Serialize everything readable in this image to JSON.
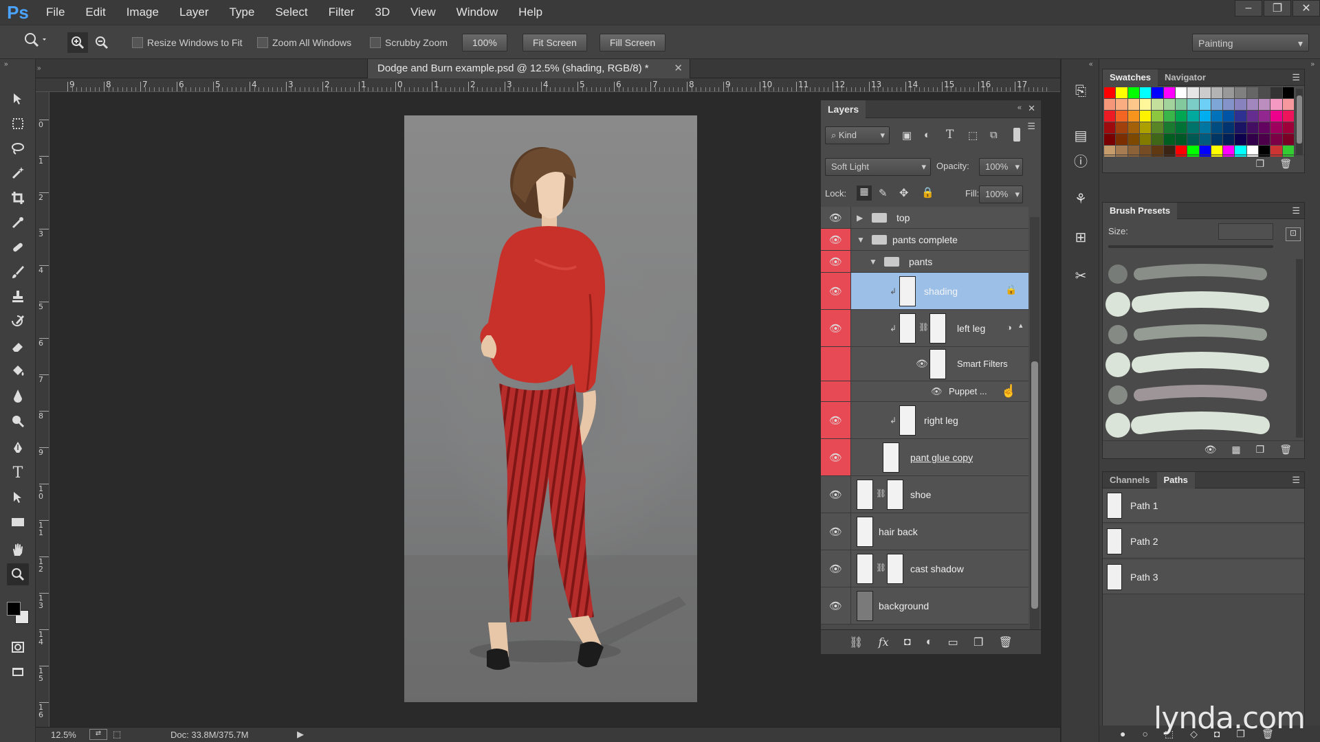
{
  "app": {
    "logo": "Ps",
    "menu": [
      "File",
      "Edit",
      "Image",
      "Layer",
      "Type",
      "Select",
      "Filter",
      "3D",
      "View",
      "Window",
      "Help"
    ],
    "window_controls": [
      "–",
      "❐",
      "✕"
    ]
  },
  "options": {
    "resize_windows": "Resize Windows to Fit",
    "zoom_all": "Zoom All Windows",
    "scrubby": "Scrubby Zoom",
    "zoom_100": "100%",
    "fit_screen": "Fit Screen",
    "fill_screen": "Fill Screen",
    "workspace": "Painting"
  },
  "tabs": {
    "active": "Dodge and Burn example.psd @ 12.5% (shading, RGB/8) *",
    "close": "✕"
  },
  "ruler": {
    "h_labels": [
      "9",
      "8",
      "7",
      "6",
      "5",
      "4",
      "3",
      "2",
      "1",
      "0",
      "1",
      "2",
      "3",
      "4",
      "5",
      "6",
      "7",
      "8",
      "9",
      "10",
      "11",
      "12",
      "13",
      "14",
      "15",
      "16",
      "17"
    ],
    "v_labels": [
      "0",
      "1",
      "2",
      "3",
      "4",
      "5",
      "6",
      "7",
      "8",
      "9",
      "1 0",
      "1 1",
      "1 2",
      "1 3",
      "1 4",
      "1 5",
      "1 6"
    ]
  },
  "status": {
    "zoom": "12.5%",
    "doc": "Doc: 33.8M/375.7M"
  },
  "layers": {
    "title": "Layers",
    "kind": "Kind",
    "blend_mode": "Soft Light",
    "opacity_label": "Opacity:",
    "opacity": "100%",
    "lock_label": "Lock:",
    "fill_label": "Fill:",
    "fill": "100%",
    "items": [
      {
        "name": "top"
      },
      {
        "name": "pants complete"
      },
      {
        "name": "pants"
      },
      {
        "name": "shading"
      },
      {
        "name": "left leg"
      },
      {
        "name": "Smart Filters"
      },
      {
        "name": "Puppet ..."
      },
      {
        "name": "right leg"
      },
      {
        "name": "pant glue copy"
      },
      {
        "name": "shoe"
      },
      {
        "name": "hair back"
      },
      {
        "name": "cast shadow"
      },
      {
        "name": "background"
      }
    ]
  },
  "swatches": {
    "tabs": [
      "Swatches",
      "Navigator"
    ],
    "colors": [
      "#ff0000",
      "#ffff00",
      "#00ff00",
      "#00ffff",
      "#0000ff",
      "#ff00ff",
      "#ffffff",
      "#e6e6e6",
      "#cccccc",
      "#b3b3b3",
      "#999999",
      "#808080",
      "#666666",
      "#4d4d4d",
      "#333333",
      "#000000",
      "#f7977a",
      "#f9ad81",
      "#fdc68a",
      "#fff79a",
      "#c4df9b",
      "#a3d39c",
      "#82ca9d",
      "#7bcdc8",
      "#6ecff6",
      "#7ea7d8",
      "#8493ca",
      "#8882be",
      "#a187be",
      "#bc8dbf",
      "#f49ac2",
      "#f6989d",
      "#ed1c24",
      "#f26522",
      "#f7941d",
      "#fff200",
      "#8dc73f",
      "#39b54a",
      "#00a651",
      "#00a99d",
      "#00aeef",
      "#0072bc",
      "#0054a6",
      "#2e3192",
      "#662d91",
      "#92278f",
      "#ec008c",
      "#ed145b",
      "#9e0b0f",
      "#a0410d",
      "#a36209",
      "#aba000",
      "#598527",
      "#1a7b30",
      "#007236",
      "#00746b",
      "#0076a3",
      "#004b80",
      "#003471",
      "#1b1464",
      "#440e62",
      "#630460",
      "#9e005d",
      "#9e0039",
      "#790000",
      "#7b2e00",
      "#7d4900",
      "#827b00",
      "#406618",
      "#005e20",
      "#005826",
      "#005952",
      "#005b7f",
      "#003663",
      "#002157",
      "#0d004c",
      "#32004b",
      "#4b0049",
      "#7b0046",
      "#7a0026",
      "#c69c6d",
      "#a67c52",
      "#8c6239",
      "#754c24",
      "#603913",
      "#3c2415",
      "#ff0000",
      "#00ff00",
      "#0000ff",
      "#ffff00",
      "#ff00ff",
      "#00ffff",
      "#ffffff",
      "#000000",
      "#cc3333",
      "#33cc33"
    ]
  },
  "brush_presets": {
    "title": "Brush Presets",
    "size_label": "Size:"
  },
  "paths": {
    "tabs": [
      "Channels",
      "Paths"
    ],
    "items": [
      "Path 1",
      "Path 2",
      "Path 3"
    ]
  },
  "watermark": "lynda.com"
}
